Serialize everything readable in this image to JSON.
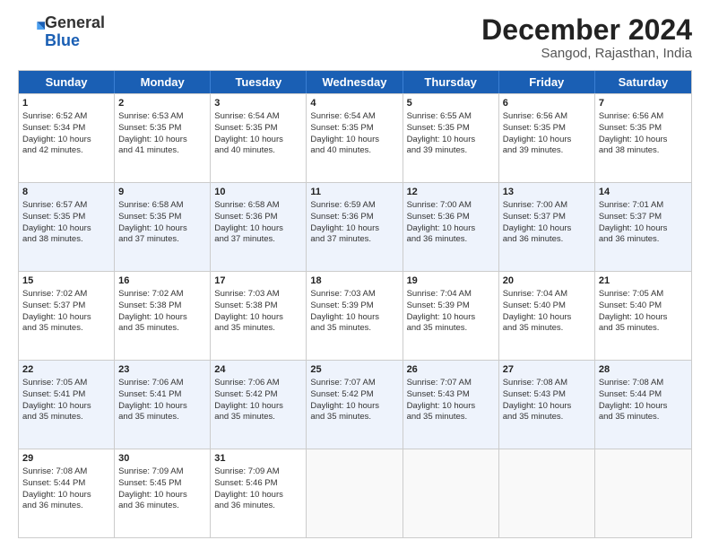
{
  "logo": {
    "general": "General",
    "blue": "Blue"
  },
  "header": {
    "month": "December 2024",
    "location": "Sangod, Rajasthan, India"
  },
  "weekdays": [
    "Sunday",
    "Monday",
    "Tuesday",
    "Wednesday",
    "Thursday",
    "Friday",
    "Saturday"
  ],
  "rows": [
    [
      {
        "day": "1",
        "lines": [
          "Sunrise: 6:52 AM",
          "Sunset: 5:34 PM",
          "Daylight: 10 hours",
          "and 42 minutes."
        ]
      },
      {
        "day": "2",
        "lines": [
          "Sunrise: 6:53 AM",
          "Sunset: 5:35 PM",
          "Daylight: 10 hours",
          "and 41 minutes."
        ]
      },
      {
        "day": "3",
        "lines": [
          "Sunrise: 6:54 AM",
          "Sunset: 5:35 PM",
          "Daylight: 10 hours",
          "and 40 minutes."
        ]
      },
      {
        "day": "4",
        "lines": [
          "Sunrise: 6:54 AM",
          "Sunset: 5:35 PM",
          "Daylight: 10 hours",
          "and 40 minutes."
        ]
      },
      {
        "day": "5",
        "lines": [
          "Sunrise: 6:55 AM",
          "Sunset: 5:35 PM",
          "Daylight: 10 hours",
          "and 39 minutes."
        ]
      },
      {
        "day": "6",
        "lines": [
          "Sunrise: 6:56 AM",
          "Sunset: 5:35 PM",
          "Daylight: 10 hours",
          "and 39 minutes."
        ]
      },
      {
        "day": "7",
        "lines": [
          "Sunrise: 6:56 AM",
          "Sunset: 5:35 PM",
          "Daylight: 10 hours",
          "and 38 minutes."
        ]
      }
    ],
    [
      {
        "day": "8",
        "lines": [
          "Sunrise: 6:57 AM",
          "Sunset: 5:35 PM",
          "Daylight: 10 hours",
          "and 38 minutes."
        ]
      },
      {
        "day": "9",
        "lines": [
          "Sunrise: 6:58 AM",
          "Sunset: 5:35 PM",
          "Daylight: 10 hours",
          "and 37 minutes."
        ]
      },
      {
        "day": "10",
        "lines": [
          "Sunrise: 6:58 AM",
          "Sunset: 5:36 PM",
          "Daylight: 10 hours",
          "and 37 minutes."
        ]
      },
      {
        "day": "11",
        "lines": [
          "Sunrise: 6:59 AM",
          "Sunset: 5:36 PM",
          "Daylight: 10 hours",
          "and 37 minutes."
        ]
      },
      {
        "day": "12",
        "lines": [
          "Sunrise: 7:00 AM",
          "Sunset: 5:36 PM",
          "Daylight: 10 hours",
          "and 36 minutes."
        ]
      },
      {
        "day": "13",
        "lines": [
          "Sunrise: 7:00 AM",
          "Sunset: 5:37 PM",
          "Daylight: 10 hours",
          "and 36 minutes."
        ]
      },
      {
        "day": "14",
        "lines": [
          "Sunrise: 7:01 AM",
          "Sunset: 5:37 PM",
          "Daylight: 10 hours",
          "and 36 minutes."
        ]
      }
    ],
    [
      {
        "day": "15",
        "lines": [
          "Sunrise: 7:02 AM",
          "Sunset: 5:37 PM",
          "Daylight: 10 hours",
          "and 35 minutes."
        ]
      },
      {
        "day": "16",
        "lines": [
          "Sunrise: 7:02 AM",
          "Sunset: 5:38 PM",
          "Daylight: 10 hours",
          "and 35 minutes."
        ]
      },
      {
        "day": "17",
        "lines": [
          "Sunrise: 7:03 AM",
          "Sunset: 5:38 PM",
          "Daylight: 10 hours",
          "and 35 minutes."
        ]
      },
      {
        "day": "18",
        "lines": [
          "Sunrise: 7:03 AM",
          "Sunset: 5:39 PM",
          "Daylight: 10 hours",
          "and 35 minutes."
        ]
      },
      {
        "day": "19",
        "lines": [
          "Sunrise: 7:04 AM",
          "Sunset: 5:39 PM",
          "Daylight: 10 hours",
          "and 35 minutes."
        ]
      },
      {
        "day": "20",
        "lines": [
          "Sunrise: 7:04 AM",
          "Sunset: 5:40 PM",
          "Daylight: 10 hours",
          "and 35 minutes."
        ]
      },
      {
        "day": "21",
        "lines": [
          "Sunrise: 7:05 AM",
          "Sunset: 5:40 PM",
          "Daylight: 10 hours",
          "and 35 minutes."
        ]
      }
    ],
    [
      {
        "day": "22",
        "lines": [
          "Sunrise: 7:05 AM",
          "Sunset: 5:41 PM",
          "Daylight: 10 hours",
          "and 35 minutes."
        ]
      },
      {
        "day": "23",
        "lines": [
          "Sunrise: 7:06 AM",
          "Sunset: 5:41 PM",
          "Daylight: 10 hours",
          "and 35 minutes."
        ]
      },
      {
        "day": "24",
        "lines": [
          "Sunrise: 7:06 AM",
          "Sunset: 5:42 PM",
          "Daylight: 10 hours",
          "and 35 minutes."
        ]
      },
      {
        "day": "25",
        "lines": [
          "Sunrise: 7:07 AM",
          "Sunset: 5:42 PM",
          "Daylight: 10 hours",
          "and 35 minutes."
        ]
      },
      {
        "day": "26",
        "lines": [
          "Sunrise: 7:07 AM",
          "Sunset: 5:43 PM",
          "Daylight: 10 hours",
          "and 35 minutes."
        ]
      },
      {
        "day": "27",
        "lines": [
          "Sunrise: 7:08 AM",
          "Sunset: 5:43 PM",
          "Daylight: 10 hours",
          "and 35 minutes."
        ]
      },
      {
        "day": "28",
        "lines": [
          "Sunrise: 7:08 AM",
          "Sunset: 5:44 PM",
          "Daylight: 10 hours",
          "and 35 minutes."
        ]
      }
    ],
    [
      {
        "day": "29",
        "lines": [
          "Sunrise: 7:08 AM",
          "Sunset: 5:44 PM",
          "Daylight: 10 hours",
          "and 36 minutes."
        ]
      },
      {
        "day": "30",
        "lines": [
          "Sunrise: 7:09 AM",
          "Sunset: 5:45 PM",
          "Daylight: 10 hours",
          "and 36 minutes."
        ]
      },
      {
        "day": "31",
        "lines": [
          "Sunrise: 7:09 AM",
          "Sunset: 5:46 PM",
          "Daylight: 10 hours",
          "and 36 minutes."
        ]
      },
      {
        "day": "",
        "lines": []
      },
      {
        "day": "",
        "lines": []
      },
      {
        "day": "",
        "lines": []
      },
      {
        "day": "",
        "lines": []
      }
    ]
  ]
}
